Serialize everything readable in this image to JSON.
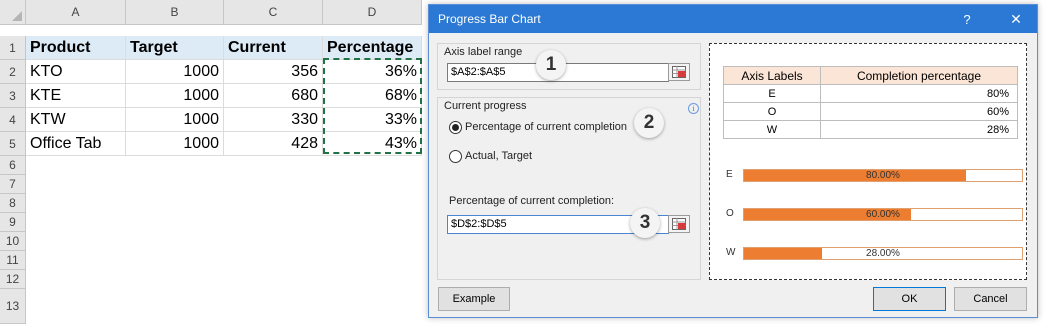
{
  "spreadsheet": {
    "columns": [
      "A",
      "B",
      "C",
      "D"
    ],
    "rows": [
      "1",
      "2",
      "3",
      "4",
      "5",
      "6",
      "7",
      "8",
      "9",
      "10",
      "11",
      "12",
      "13"
    ],
    "header": [
      "Product",
      "Target",
      "Current",
      "Percentage"
    ],
    "data": [
      [
        "KTO",
        "1000",
        "356",
        "36%"
      ],
      [
        "KTE",
        "1000",
        "680",
        "68%"
      ],
      [
        "KTW",
        "1000",
        "330",
        "33%"
      ],
      [
        "Office Tab",
        "1000",
        "428",
        "43%"
      ]
    ]
  },
  "dialog": {
    "title": "Progress Bar Chart",
    "help": "?",
    "close": "✕",
    "axis_label_range_label": "Axis label range",
    "axis_label_range_value": "$A$2:$A$5",
    "current_progress_label": "Current progress",
    "info_icon": "i",
    "radio_percentage_label": "Percentage of current completion",
    "radio_actual_label": "Actual, Target",
    "percentage_field_label": "Percentage of current completion:",
    "percentage_range_value": "$D$2:$D$5",
    "badges": [
      "1",
      "2",
      "3"
    ],
    "example_button": "Example",
    "ok_button": "OK",
    "cancel_button": "Cancel",
    "preview": {
      "table_headers": [
        "Axis Labels",
        "Completion percentage"
      ],
      "table_rows": [
        [
          "E",
          "80%"
        ],
        [
          "O",
          "60%"
        ],
        [
          "W",
          "28%"
        ]
      ],
      "bars": [
        {
          "label": "E",
          "value": 0.8,
          "text": "80.00%"
        },
        {
          "label": "O",
          "value": 0.6,
          "text": "60.00%"
        },
        {
          "label": "W",
          "value": 0.28,
          "text": "28.00%"
        }
      ]
    }
  },
  "colors": {
    "titlebar": "#2b79d4",
    "header_fill": "#ddebf7",
    "bar_fill": "#ed7d31",
    "table_header_fill": "#fbe5d6",
    "selection_marquee": "#217346"
  },
  "icons": {
    "range_button": "range-select-icon",
    "info": "info-icon",
    "help": "help-icon",
    "close": "close-icon"
  }
}
